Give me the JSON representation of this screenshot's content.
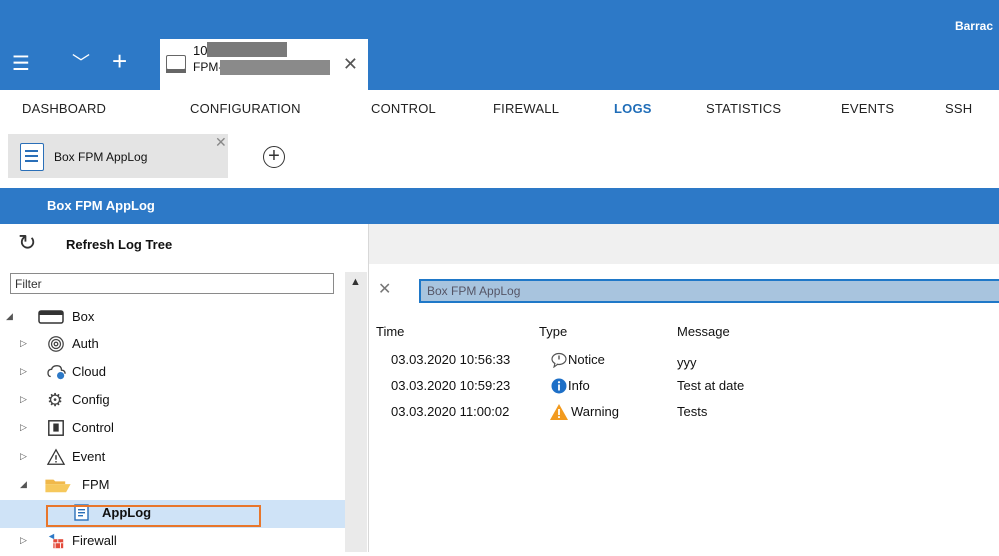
{
  "titlebar": {
    "brand": "Barrac",
    "tab_line1": "10.",
    "tab_line2": "FPM-",
    "tab_close": "✕"
  },
  "nav": {
    "items": [
      "DASHBOARD",
      "CONFIGURATION",
      "CONTROL",
      "FIREWALL",
      "LOGS",
      "STATISTICS",
      "EVENTS",
      "SSH"
    ],
    "active": "LOGS"
  },
  "subtabs": {
    "tab_label": "Box FPM AppLog",
    "tab_close": "✕",
    "add": "+"
  },
  "section": {
    "title": "Box FPM AppLog"
  },
  "left": {
    "refresh_label": "Refresh Log Tree",
    "filter_placeholder": "Filter",
    "tree": [
      "Box",
      "Auth",
      "Cloud",
      "Config",
      "Control",
      "Event",
      "FPM",
      "AppLog",
      "Firewall"
    ]
  },
  "right": {
    "clear": "✕",
    "search_value": "Box FPM AppLog",
    "columns": {
      "time": "Time",
      "type": "Type",
      "message": "Message"
    },
    "rows": [
      {
        "time": "03.03.2020 10:56:33",
        "type": "Notice",
        "message": "yyy"
      },
      {
        "time": "03.03.2020 10:59:23",
        "type": "Info",
        "message": "Test at date"
      },
      {
        "time": "03.03.2020 11:00:02",
        "type": "Warning",
        "message": "Tests"
      }
    ]
  },
  "colors": {
    "accent": "#2d79c7",
    "highlight": "#e8762b",
    "selected": "#cfe3f7"
  }
}
